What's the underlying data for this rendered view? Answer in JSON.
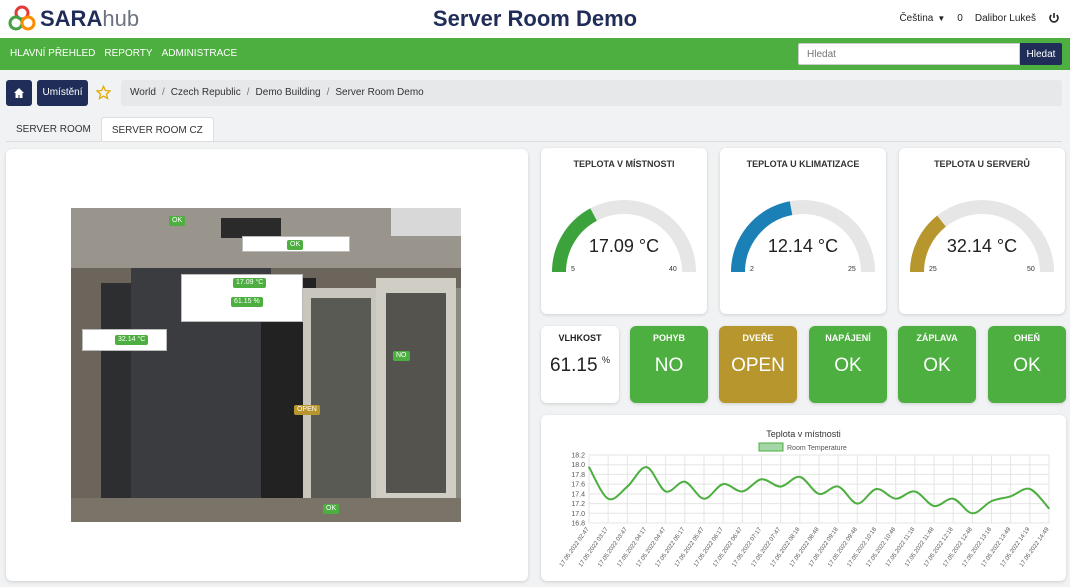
{
  "app": {
    "logo_main": "SARA",
    "logo_sub": "hub",
    "page_title": "Server Room Demo"
  },
  "user_menu": {
    "language": "Čeština",
    "counter": "0",
    "user_name": "Dalibor Lukeš"
  },
  "nav": {
    "items": [
      "HLAVNÍ PŘEHLED",
      "REPORTY",
      "ADMINISTRACE"
    ]
  },
  "search": {
    "placeholder": "Hledat",
    "button": "Hledat"
  },
  "toolbar": {
    "location_button": "Umístění"
  },
  "breadcrumb": [
    "World",
    "Czech Republic",
    "Demo Building",
    "Server Room Demo"
  ],
  "tabs": [
    {
      "label": "SERVER ROOM",
      "active": false
    },
    {
      "label": "SERVER ROOM CZ",
      "active": true
    }
  ],
  "photo_labels": {
    "top_ok": "OK",
    "ceiling_ok": "OK",
    "temp": "17.09 °C",
    "humidity": "61.15 %",
    "rack_temp": "32.14 °C",
    "rack_no": "NO",
    "door_open": "OPEN",
    "floor_ok": "OK"
  },
  "gauges": [
    {
      "title": "TEPLOTA V MÍSTNOSTI",
      "value": "17.09 °C",
      "min": "5",
      "max": "40",
      "fraction": 0.345,
      "color": "#3ca33c"
    },
    {
      "title": "TEPLOTA U KLIMATIZACE",
      "value": "12.14 °C",
      "min": "2",
      "max": "25",
      "fraction": 0.441,
      "color": "#1a80b6"
    },
    {
      "title": "TEPLOTA U SERVERŮ",
      "value": "32.14 °C",
      "min": "25",
      "max": "50",
      "fraction": 0.286,
      "color": "#b8962e"
    }
  ],
  "humidity_tile": {
    "title": "VLHKOST",
    "value": "61.15",
    "unit": "%"
  },
  "status_tiles": [
    {
      "title": "POHYB",
      "value": "NO",
      "color": "#4caf3f"
    },
    {
      "title": "DVEŘE",
      "value": "OPEN",
      "color": "#b8962e"
    },
    {
      "title": "NAPÁJENÍ",
      "value": "OK",
      "color": "#4caf3f"
    },
    {
      "title": "ZÁPLAVA",
      "value": "OK",
      "color": "#4caf3f"
    },
    {
      "title": "OHEŇ",
      "value": "OK",
      "color": "#4caf3f"
    }
  ],
  "chart_data": {
    "type": "line",
    "title": "Teplota v místnosti",
    "legend": "Room Temperature",
    "legend_position": "top",
    "ylim": [
      16.8,
      18.2
    ],
    "yticks": [
      "18.2",
      "18.0",
      "17.8",
      "17.6",
      "17.4",
      "17.2",
      "17.0",
      "16.8"
    ],
    "x": [
      "17.05.2022 02:47",
      "17.05.2022 03:17",
      "17.05.2022 03:47",
      "17.05.2022 04:17",
      "17.05.2022 04:47",
      "17.05.2022 05:17",
      "17.05.2022 05:47",
      "17.05.2022 06:17",
      "17.05.2022 06:47",
      "17.05.2022 07:17",
      "17.05.2022 07:47",
      "17.05.2022 08:18",
      "17.05.2022 08:48",
      "17.05.2022 09:18",
      "17.05.2022 09:48",
      "17.05.2022 10:18",
      "17.05.2022 10:48",
      "17.05.2022 11:18",
      "17.05.2022 11:48",
      "17.05.2022 12:18",
      "17.05.2022 12:48",
      "17.05.2022 13:18",
      "17.05.2022 13:49",
      "17.05.2022 14:19",
      "17.05.2022 14:49"
    ],
    "values": [
      17.95,
      17.3,
      17.55,
      17.95,
      17.45,
      17.65,
      17.3,
      17.6,
      17.45,
      17.7,
      17.55,
      17.75,
      17.4,
      17.55,
      17.2,
      17.5,
      17.3,
      17.45,
      17.15,
      17.3,
      17.0,
      17.25,
      17.35,
      17.5,
      17.1
    ],
    "color": "#4caf3f",
    "grid": true
  }
}
